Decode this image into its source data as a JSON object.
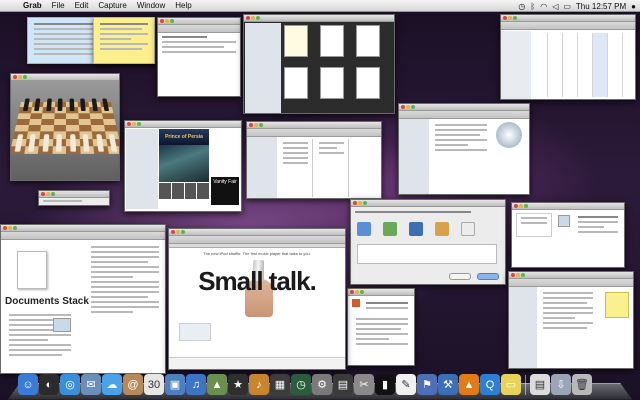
{
  "menubar": {
    "apple_glyph": "",
    "app_name": "Grab",
    "items": [
      "File",
      "Edit",
      "Capture",
      "Window",
      "Help"
    ],
    "clock": "Thu 12:57 PM"
  },
  "status_icons": [
    "time-machine-icon",
    "bluetooth-icon",
    "wifi-icon",
    "volume-icon",
    "battery-icon",
    "user-icon"
  ],
  "windows": {
    "safari": {
      "headline": "The new iPod shuffle. The first music player that talks to you.",
      "big_text": "Small talk."
    },
    "documents_stack": {
      "title": "Documents Stack"
    },
    "itunes": {
      "banner": "Prince of Persia",
      "ad": "Vanity Fair"
    }
  },
  "dock": {
    "items": [
      {
        "icon": "finder-icon",
        "color": "#3a7bd5",
        "glyph": "☺"
      },
      {
        "icon": "dashboard-icon",
        "color": "#2b2b2b",
        "glyph": "◐"
      },
      {
        "icon": "safari-icon",
        "color": "#3b8fd8",
        "glyph": "◎"
      },
      {
        "icon": "mail-icon",
        "color": "#6a8fb8",
        "glyph": "✉"
      },
      {
        "icon": "ichat-icon",
        "color": "#4aa3e8",
        "glyph": "☁"
      },
      {
        "icon": "address-book-icon",
        "color": "#b48a5a",
        "glyph": "@"
      },
      {
        "icon": "ical-icon",
        "color": "#e6e6e6",
        "glyph": "30"
      },
      {
        "icon": "preview-icon",
        "color": "#4f7fbf",
        "glyph": "▣"
      },
      {
        "icon": "itunes-icon",
        "color": "#3d74c6",
        "glyph": "♫"
      },
      {
        "icon": "iphoto-icon",
        "color": "#6b8f4f",
        "glyph": "▲"
      },
      {
        "icon": "imovie-icon",
        "color": "#2f2f2f",
        "glyph": "★"
      },
      {
        "icon": "garageband-icon",
        "color": "#c9852e",
        "glyph": "♪"
      },
      {
        "icon": "spaces-icon",
        "color": "#3c3c3c",
        "glyph": "▦"
      },
      {
        "icon": "time-machine-icon",
        "color": "#2b5d3d",
        "glyph": "◷"
      },
      {
        "icon": "system-preferences-icon",
        "color": "#7a7a7a",
        "glyph": "⚙"
      },
      {
        "icon": "photo-booth-icon",
        "color": "#3a3a3a",
        "glyph": "▤"
      },
      {
        "icon": "grab-icon",
        "color": "#8a8a8a",
        "glyph": "✂"
      },
      {
        "icon": "terminal-icon",
        "color": "#111111",
        "glyph": "▮"
      },
      {
        "icon": "textedit-icon",
        "color": "#f0f0f0",
        "glyph": "✎"
      },
      {
        "icon": "keynote-icon",
        "color": "#4d6fb5",
        "glyph": "⚑"
      },
      {
        "icon": "xcode-icon",
        "color": "#3c6fb5",
        "glyph": "⚒"
      },
      {
        "icon": "vlc-icon",
        "color": "#e27a16",
        "glyph": "▲"
      },
      {
        "icon": "quicktime-icon",
        "color": "#2d7fd3",
        "glyph": "Q"
      },
      {
        "icon": "stickies-icon",
        "color": "#e8d35a",
        "glyph": "▭"
      }
    ],
    "right_items": [
      {
        "icon": "documents-stack-icon",
        "color": "#dcdcdc",
        "glyph": "▤"
      },
      {
        "icon": "downloads-stack-icon",
        "color": "#9aa6b8",
        "glyph": "⇩"
      },
      {
        "icon": "trash-icon",
        "color": "#b8b8b8",
        "glyph": "🗑"
      }
    ]
  }
}
